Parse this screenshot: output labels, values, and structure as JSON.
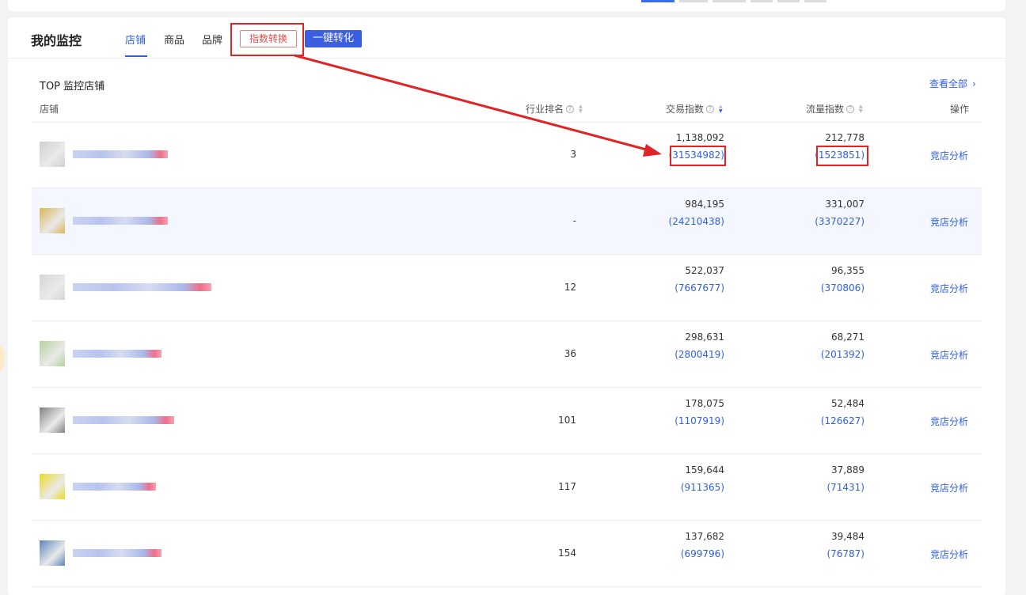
{
  "card": {
    "title": "我的监控",
    "tabs": [
      {
        "label": "店铺",
        "active": true
      },
      {
        "label": "商品",
        "active": false
      },
      {
        "label": "品牌",
        "active": false
      }
    ],
    "convert_button": "指数转换",
    "one_click_button": "一键转化"
  },
  "section": {
    "title": "TOP 监控店铺",
    "view_all": "查看全部"
  },
  "table": {
    "headers": {
      "shop": "店铺",
      "rank": "行业排名",
      "trade": "交易指数",
      "flow": "流量指数",
      "op": "操作"
    },
    "rows": [
      {
        "rank": "3",
        "trade": "1,138,092",
        "trade_conv": "(31534982)",
        "flow": "212,778",
        "flow_conv": "(1523851)",
        "op": "竞店分析",
        "thumb_color": "#c8c8c8"
      },
      {
        "rank": "-",
        "trade": "984,195",
        "trade_conv": "(24210438)",
        "flow": "331,007",
        "flow_conv": "(3370227)",
        "op": "竞店分析",
        "thumb_color": "#d9a93a"
      },
      {
        "rank": "12",
        "trade": "522,037",
        "trade_conv": "(7667677)",
        "flow": "96,355",
        "flow_conv": "(370806)",
        "op": "竞店分析",
        "thumb_color": "#cfcfcf"
      },
      {
        "rank": "36",
        "trade": "298,631",
        "trade_conv": "(2800419)",
        "flow": "68,271",
        "flow_conv": "(201392)",
        "op": "竞店分析",
        "thumb_color": "#a8c88a"
      },
      {
        "rank": "101",
        "trade": "178,075",
        "trade_conv": "(1107919)",
        "flow": "52,484",
        "flow_conv": "(126627)",
        "op": "竞店分析",
        "thumb_color": "#6b6b6b"
      },
      {
        "rank": "117",
        "trade": "159,644",
        "trade_conv": "(911365)",
        "flow": "37,889",
        "flow_conv": "(71431)",
        "op": "竞店分析",
        "thumb_color": "#e8d400"
      },
      {
        "rank": "154",
        "trade": "137,682",
        "trade_conv": "(699796)",
        "flow": "39,484",
        "flow_conv": "(76787)",
        "op": "竞店分析",
        "thumb_color": "#3f6fb0"
      }
    ]
  },
  "colors": {
    "accent": "#2e5fe6",
    "highlight": "#e02424"
  }
}
